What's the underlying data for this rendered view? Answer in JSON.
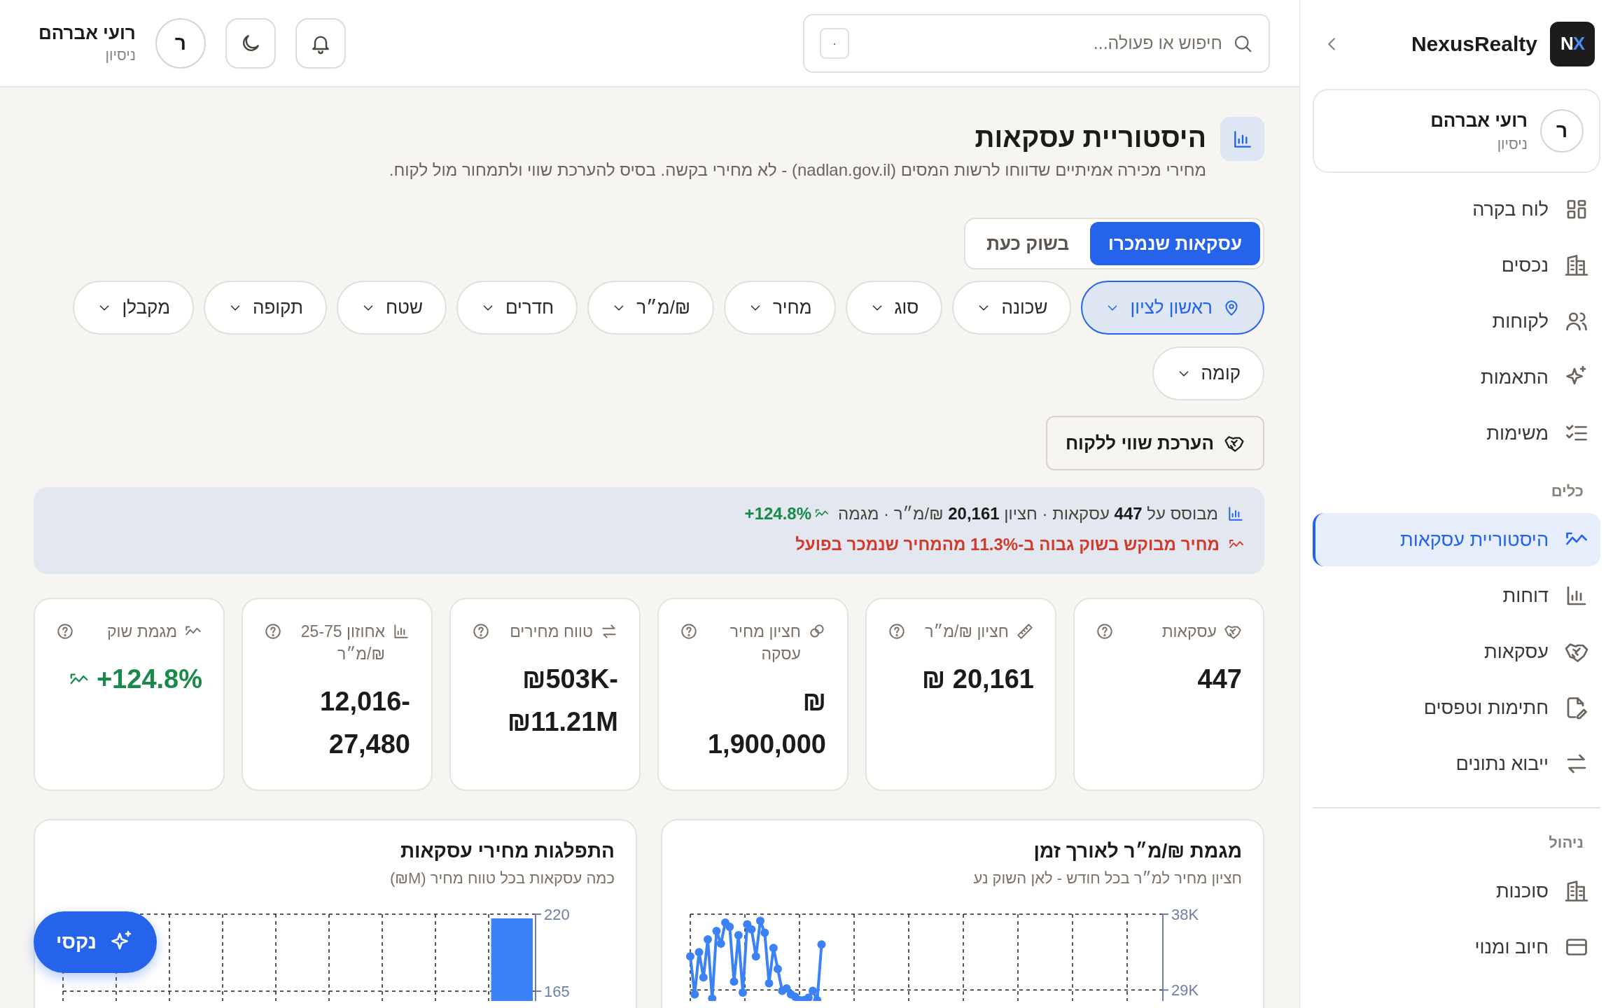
{
  "topbar": {
    "search": {
      "placeholder": "חיפוש או פעולה...",
      "shortcut": "·"
    },
    "user": {
      "initial": "ר",
      "name": "רועי אברהם",
      "role": "ניסיון"
    }
  },
  "sidebar": {
    "logo": "NX",
    "brand": "NexusRealty",
    "user": {
      "initial": "ר",
      "name": "רועי אברהם",
      "role": "ניסיון"
    },
    "sections": [
      {
        "items": [
          {
            "label": "לוח בקרה",
            "selected": false
          },
          {
            "label": "נכסים",
            "selected": false
          },
          {
            "label": "לקוחות",
            "selected": false
          },
          {
            "label": "התאמות",
            "selected": false
          },
          {
            "label": "משימות",
            "selected": false
          }
        ]
      },
      {
        "title": "כלים",
        "items": [
          {
            "label": "היסטוריית עסקאות",
            "selected": true
          },
          {
            "label": "דוחות",
            "selected": false
          },
          {
            "label": "עסקאות",
            "selected": false
          },
          {
            "label": "חתימות וטפסים",
            "selected": false
          },
          {
            "label": "ייבוא נתונים",
            "selected": false
          }
        ]
      },
      {
        "title": "ניהול",
        "items": [
          {
            "label": "סוכנות",
            "selected": false
          },
          {
            "label": "חיוב ומנוי",
            "selected": false
          }
        ]
      }
    ]
  },
  "page": {
    "title": "היסטוריית עסקאות",
    "subtitle": "מחירי מכירה אמיתיים שדווחו לרשות המסים (nadlan.gov.il) - לא מחירי בקשה. בסיס להערכת שווי ולתמחור מול לקוח.",
    "tabs": [
      {
        "label": "עסקאות שנמכרו",
        "selected": true
      },
      {
        "label": "בשוק כעת",
        "selected": false
      }
    ],
    "filters": [
      {
        "label": "ראשון לציון",
        "selected": true
      },
      {
        "label": "שכונה",
        "selected": false
      },
      {
        "label": "סוג",
        "selected": false
      },
      {
        "label": "מחיר",
        "selected": false
      },
      {
        "label": "₪/מ״ר",
        "selected": false
      },
      {
        "label": "חדרים",
        "selected": false
      },
      {
        "label": "שטח",
        "selected": false
      },
      {
        "label": "תקופה",
        "selected": false
      },
      {
        "label": "מקבלן",
        "selected": false
      },
      {
        "label": "קומה",
        "selected": false
      }
    ],
    "action": "הערכת שווי ללקוח"
  },
  "banner": {
    "summary": "מבוסס על **447** עסקאות · חציון **20,161** ₪/מ״ר · מגמה",
    "trend": "+124.8%",
    "alert": "מחיר מבוקש בשוק גבוה ב-11.3% מהמחיר שנמכר בפועל"
  },
  "stats": [
    {
      "kind": "metric",
      "label": "עסקאות",
      "value": "447",
      "color": "#1d1b19"
    },
    {
      "kind": "metric",
      "label": "חציון ₪/מ״ר",
      "value": "₪ 20,161",
      "color": "#1d1b19"
    },
    {
      "kind": "metric",
      "label": "חציון מחיר עסקה",
      "value": "₪ 1,900,000",
      "color": "#1d1b19"
    },
    {
      "kind": "metric",
      "label": "טווח מחירים",
      "value": "₪503K-₪11.21M",
      "color": "#1d1b19"
    },
    {
      "kind": "metric",
      "label": "אחוזון 25-75 ₪/מ״ר",
      "value": "12,016-27,480",
      "color": "#1d1b19"
    },
    {
      "kind": "trend",
      "label": "מגמת שוק",
      "value": "+124.8%",
      "color": "#1a8a4a"
    }
  ],
  "charts": [
    {
      "title": "מגמת ₪/מ״ר לאורך זמן",
      "subtitle": "חציון מחיר למ״ר בכל חודש - לאן השוק נע",
      "chart_data": {
        "type": "line",
        "categories": [
          null,
          null,
          null,
          null,
          null,
          null,
          null,
          null,
          null,
          null,
          null,
          null,
          null,
          null,
          null,
          null,
          null,
          null,
          null,
          null,
          null,
          null,
          null,
          null,
          null,
          null,
          null,
          null,
          null,
          null,
          null,
          null,
          null,
          null,
          null,
          null,
          null,
          null,
          null,
          null,
          null,
          null,
          null,
          null,
          null,
          null,
          null,
          null,
          null,
          null,
          null,
          null,
          null,
          null,
          null,
          null,
          null,
          null,
          null,
          null,
          null,
          null,
          null,
          null,
          null,
          null,
          null,
          null,
          null,
          null,
          null,
          null,
          null,
          null,
          null,
          null,
          null,
          null,
          null,
          null,
          null,
          null,
          null,
          null,
          null,
          null,
          null,
          null,
          null,
          null,
          null,
          null,
          null,
          null,
          null,
          null,
          null,
          null,
          null,
          null,
          null,
          null,
          null,
          null,
          null,
          null,
          null,
          null,
          null
        ],
        "ylim": [
          27700,
          38000
        ],
        "yticks": [
          {
            "value": 29000,
            "label": "29K"
          },
          {
            "value": 38000,
            "label": "38K"
          }
        ],
        "series": [
          {
            "color": "#3b82f6",
            "marker": "circle",
            "values": [
              33000,
              28500,
              33500,
              30500,
              35000,
              28000,
              36000,
              34500,
              37000,
              36500,
              30000,
              35500,
              28700,
              36800,
              36200,
              33000,
              37200,
              35800,
              29800,
              34000,
              31500,
              28900,
              29200,
              28500,
              28200,
              27800,
              27800,
              28100,
              28900,
              27800,
              34400,
              null,
              null,
              null,
              null,
              null,
              null,
              null,
              null,
              null,
              null,
              null,
              null,
              null,
              null,
              null,
              null,
              null,
              null,
              null,
              null,
              null,
              null,
              null,
              null,
              null,
              null,
              null,
              null,
              null,
              null,
              null,
              null,
              null,
              null,
              null,
              null,
              null,
              null,
              null,
              null,
              null,
              null,
              null,
              null,
              null,
              null,
              null,
              null,
              null,
              null,
              null,
              null,
              null,
              null,
              null,
              null,
              null,
              null,
              null,
              null,
              null,
              null,
              null,
              null,
              null,
              null,
              null,
              null,
              null,
              null,
              null,
              null,
              null,
              null,
              null,
              null,
              null,
              null
            ]
          }
        ]
      }
    },
    {
      "title": "התפלגות מחירי עסקאות",
      "subtitle": "כמה עסקאות בכל טווח מחיר (M₪)",
      "chart_data": {
        "type": "bar",
        "ylim": [
          158,
          220
        ],
        "yticks": [
          {
            "value": 165,
            "label": "165"
          },
          {
            "value": 220,
            "label": "220"
          }
        ],
        "series": [
          {
            "color": "#3b82f6",
            "values": [
              null,
              null,
              null,
              null,
              null,
              null,
              null,
              null,
              null,
              217
            ]
          }
        ]
      }
    }
  ],
  "assistant": {
    "label": "נקסי"
  }
}
